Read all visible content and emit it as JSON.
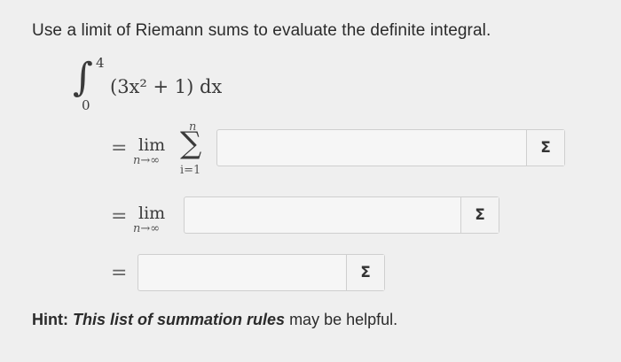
{
  "question": {
    "prompt": "Use a limit of Riemann sums to evaluate the definite integral."
  },
  "integral": {
    "symbol": "∫",
    "upper": "4",
    "lower": "0",
    "integrand": "(3x² + 1) dx"
  },
  "steps": {
    "equals": "=",
    "lim": "lim",
    "lim_sub": "n→∞",
    "sum_symbol": "∑",
    "sum_upper": "n",
    "sum_lower": "i=1",
    "field1_value": "",
    "field2_value": "",
    "field3_value": ""
  },
  "sigma_button": "Σ",
  "hint": {
    "label": "Hint:",
    "link_text": "This list of summation rules",
    "suffix": "may be helpful."
  }
}
